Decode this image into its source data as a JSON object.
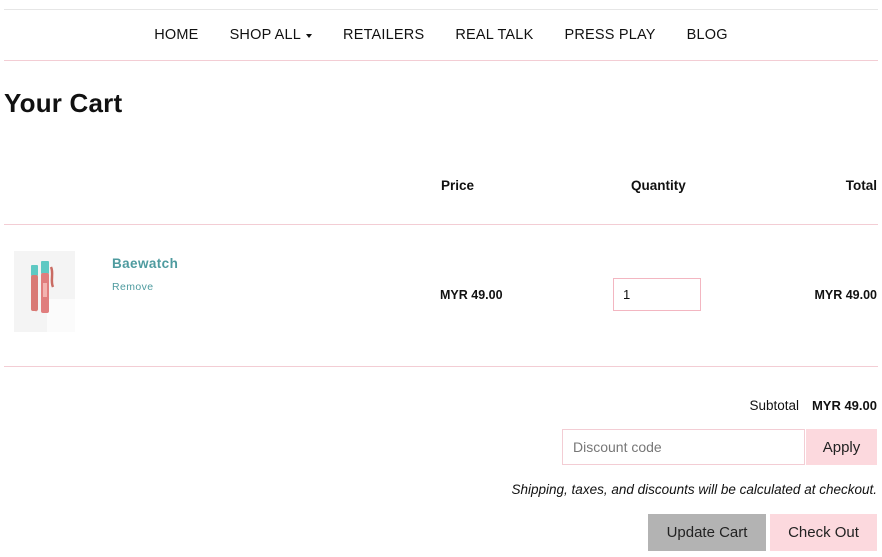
{
  "nav": {
    "items": [
      {
        "label": "HOME"
      },
      {
        "label": "SHOP ALL",
        "has_dropdown": true
      },
      {
        "label": "RETAILERS"
      },
      {
        "label": "REAL TALK"
      },
      {
        "label": "PRESS PLAY"
      },
      {
        "label": "BLOG"
      }
    ]
  },
  "page": {
    "title": "Your Cart"
  },
  "table": {
    "headers": {
      "price": "Price",
      "quantity": "Quantity",
      "total": "Total"
    },
    "rows": [
      {
        "product_name": "Baewatch",
        "remove_label": "Remove",
        "price": "MYR 49.00",
        "quantity": "1",
        "total": "MYR 49.00",
        "image_icon": "lip-gloss-product-image"
      }
    ]
  },
  "summary": {
    "subtotal_label": "Subtotal",
    "subtotal_value": "MYR 49.00",
    "discount_placeholder": "Discount code",
    "apply_label": "Apply",
    "note": "Shipping, taxes, and discounts will be calculated at checkout.",
    "update_label": "Update Cart",
    "checkout_label": "Check Out"
  },
  "colors": {
    "accent_pink": "#fcd9de",
    "rule_pink": "#f3cdd4",
    "link_teal": "#4e9b9f",
    "update_gray": "#b3b3b3"
  }
}
